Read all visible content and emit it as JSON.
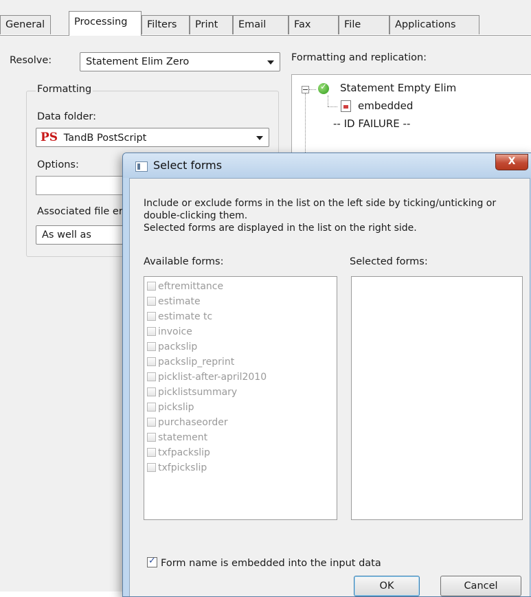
{
  "tabs": [
    {
      "label": "General"
    },
    {
      "label": "Processing"
    },
    {
      "label": "Filters"
    },
    {
      "label": "Print"
    },
    {
      "label": "Email"
    },
    {
      "label": "Fax"
    },
    {
      "label": "File"
    },
    {
      "label": "Applications"
    }
  ],
  "active_tab": "Processing",
  "processing": {
    "resolve_label": "Resolve:",
    "resolve_value": "Statement Elim Zero",
    "formatting_group": "Formatting",
    "data_folder_label": "Data folder:",
    "data_folder_icon_text": "PS",
    "data_folder_value": "TandB PostScript",
    "options_label": "Options:",
    "options_value": "",
    "associated_label": "Associated file er",
    "associated_value": "As well as",
    "replication_label": "Formatting and replication:",
    "tree": {
      "root": "Statement Empty Elim",
      "child": "embedded",
      "failure": "-- ID FAILURE --"
    }
  },
  "dialog": {
    "title": "Select forms",
    "close_label": "X",
    "description": [
      "Include or exclude forms in the list on the left side by ticking/unticking or",
      "double-clicking them.",
      "Selected forms are displayed in the list on the right side."
    ],
    "available_label": "Available forms:",
    "selected_label": "Selected forms:",
    "available_forms": [
      "eftremittance",
      "estimate",
      "estimate tc",
      "invoice",
      "packslip",
      "packslip_reprint",
      "picklist-after-april2010",
      "picklistsummary",
      "pickslip",
      "purchaseorder",
      "statement",
      "txfpackslip",
      "txfpickslip"
    ],
    "selected_forms": [],
    "embedded_checkbox_label": "Form name is embedded into the input data",
    "embedded_checked": true,
    "ok_label": "OK",
    "cancel_label": "Cancel"
  }
}
